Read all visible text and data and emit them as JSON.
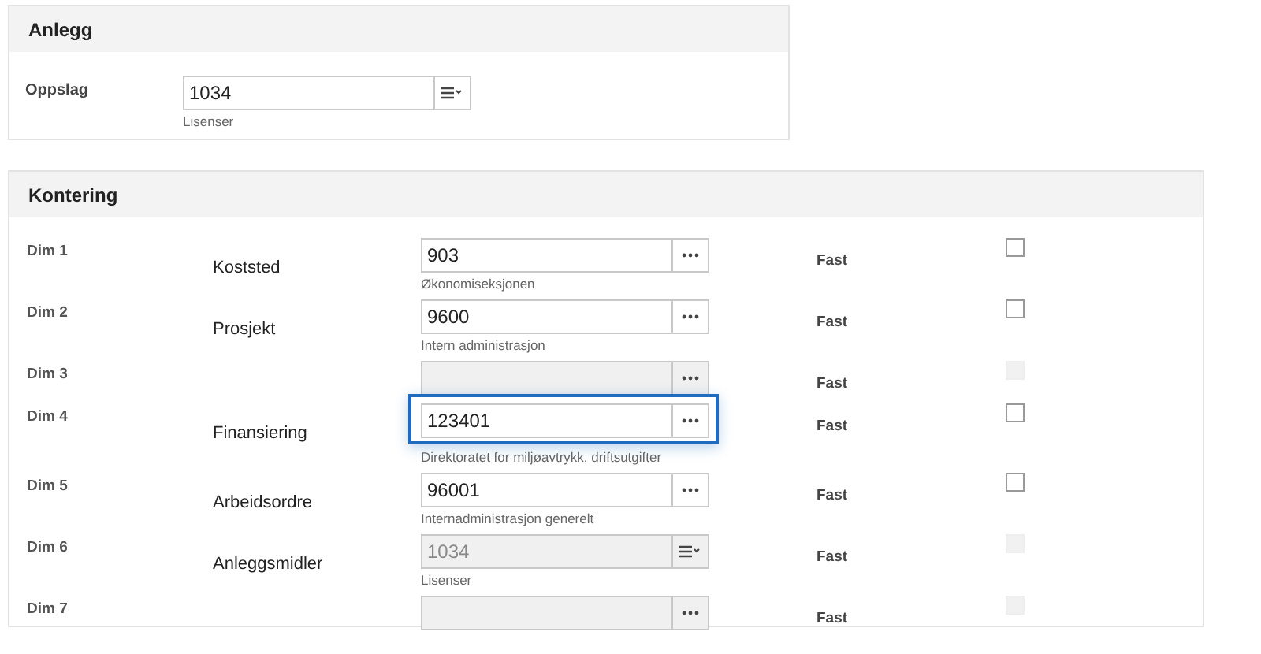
{
  "anlegg": {
    "title": "Anlegg",
    "field": {
      "label": "Oppslag",
      "value": "1034",
      "hint": "Lisenser",
      "kind": "list",
      "disabled": false
    }
  },
  "kontering": {
    "title": "Kontering",
    "rows": [
      {
        "dim": "Dim 1",
        "name": "Koststed",
        "value": "903",
        "hint": "Økonomiseksjonen",
        "kind": "lookup",
        "disabled": false,
        "focused": false,
        "fast_label": "Fast",
        "fast_checked": false,
        "fast_disabled": false
      },
      {
        "dim": "Dim 2",
        "name": "Prosjekt",
        "value": "9600",
        "hint": "Intern administrasjon",
        "kind": "lookup",
        "disabled": false,
        "focused": false,
        "fast_label": "Fast",
        "fast_checked": false,
        "fast_disabled": false
      },
      {
        "dim": "Dim 3",
        "kind": "lookup",
        "disabled": true,
        "focused": false,
        "fast_label": "Fast",
        "fast_checked": false,
        "fast_disabled": true
      },
      {
        "dim": "Dim 4",
        "name": "Finansiering",
        "value": "123401",
        "hint": "Direktoratet for miljøavtrykk, driftsutgifter",
        "kind": "lookup",
        "disabled": false,
        "focused": true,
        "fast_label": "Fast",
        "fast_checked": false,
        "fast_disabled": false
      },
      {
        "dim": "Dim 5",
        "name": "Arbeidsordre",
        "value": "96001",
        "hint": "Internadministrasjon generelt",
        "kind": "lookup",
        "disabled": false,
        "focused": false,
        "fast_label": "Fast",
        "fast_checked": false,
        "fast_disabled": false
      },
      {
        "dim": "Dim 6",
        "name": "Anleggsmidler",
        "value": "1034",
        "hint": "Lisenser",
        "kind": "list",
        "disabled": true,
        "focused": false,
        "fast_label": "Fast",
        "fast_checked": false,
        "fast_disabled": true
      },
      {
        "dim": "Dim 7",
        "kind": "lookup",
        "disabled": true,
        "focused": false,
        "fast_label": "Fast",
        "fast_checked": false,
        "fast_disabled": true
      }
    ]
  }
}
